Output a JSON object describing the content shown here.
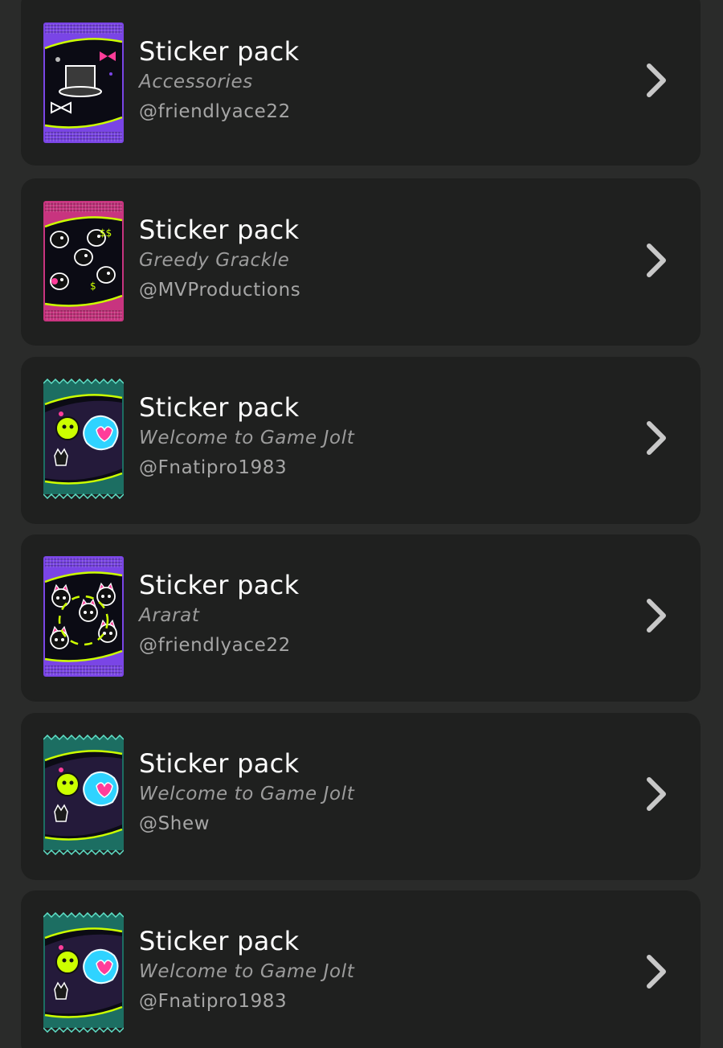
{
  "pack_list": {
    "items": [
      {
        "title": "Sticker pack",
        "name": "Accessories",
        "author": "@friendlyace22",
        "pack_color": "#7a45e6",
        "pack_art": "accessories"
      },
      {
        "title": "Sticker pack",
        "name": "Greedy Grackle",
        "author": "@MVProductions",
        "pack_color": "#c8347f",
        "pack_art": "grackle"
      },
      {
        "title": "Sticker pack",
        "name": "Welcome to Game Jolt",
        "author": "@Fnatipro1983",
        "pack_color": "#1c6e62",
        "pack_art": "welcome"
      },
      {
        "title": "Sticker pack",
        "name": "Ararat",
        "author": "@friendlyace22",
        "pack_color": "#7a45e6",
        "pack_art": "ararat"
      },
      {
        "title": "Sticker pack",
        "name": "Welcome to Game Jolt",
        "author": "@Shew",
        "pack_color": "#1c6e62",
        "pack_art": "welcome"
      },
      {
        "title": "Sticker pack",
        "name": "Welcome to Game Jolt",
        "author": "@Fnatipro1983",
        "pack_color": "#1c6e62",
        "pack_art": "welcome"
      }
    ]
  },
  "colors": {
    "background": "#2a2b2a",
    "card": "#1f201f",
    "title_text": "#ffffff",
    "secondary_text": "#9c9c9c",
    "chevron": "#c8c8c8",
    "accent_lime": "#ccff00",
    "accent_pink": "#ff3d9a",
    "accent_cyan": "#2fd3ff"
  }
}
